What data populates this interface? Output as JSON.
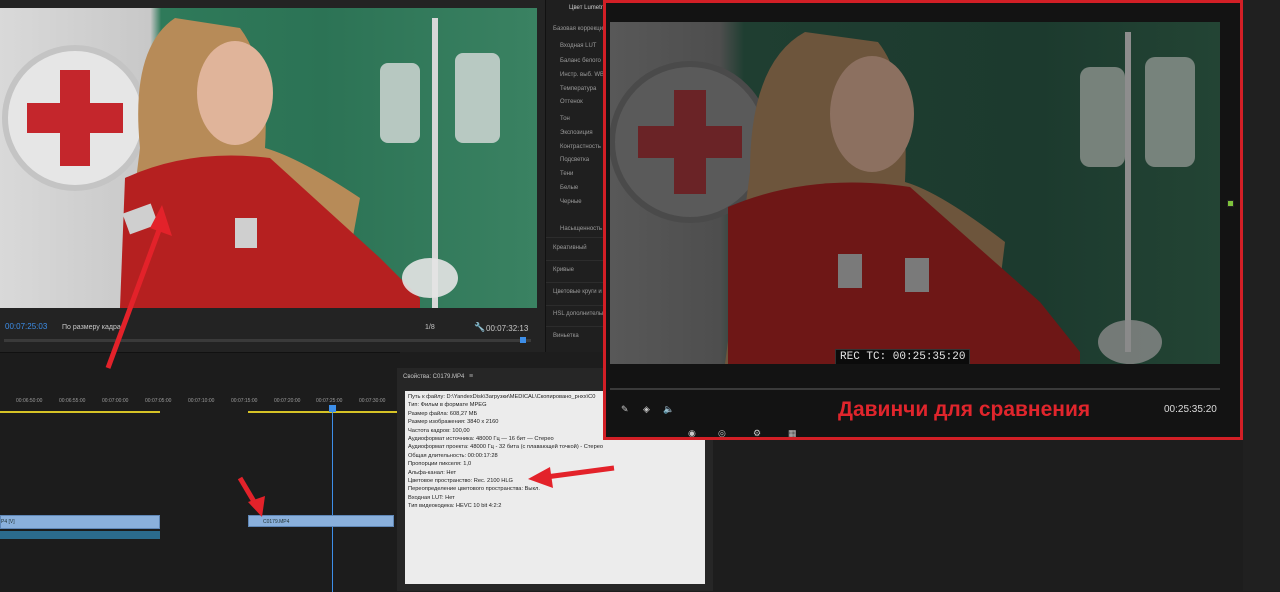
{
  "monitor": {
    "timecode_left": "00:07:25:03",
    "fit_label": "По размеру кадра",
    "resolution": "1/8",
    "timecode_right": "00:07:32:13"
  },
  "lumetri": {
    "tab": "Цвет Lumetri",
    "basic": "Базовая коррекция",
    "lut": "Входная LUT",
    "wb_group": "Баланс белого",
    "wb_picker": "Инстр. выб. WB",
    "temperature": "Температура",
    "tint": "Оттенок",
    "tone": "Тон",
    "exposure": "Экспозиция",
    "contrast": "Контрастность",
    "highlights": "Подсветка",
    "shadows": "Тени",
    "whites": "Белые",
    "blacks": "Черные",
    "saturation": "Насыщенность",
    "creative": "Креативный",
    "curves": "Кривые",
    "wheels": "Цветовые круги и к",
    "hsl": "HSL дополнительн",
    "vignette": "Виньетка"
  },
  "timeline": {
    "ticks": [
      "00:06:50:00",
      "00:06:55:00",
      "00:07:00:00",
      "00:07:05:00",
      "00:07:10:00",
      "00:07:15:00",
      "00:07:20:00",
      "00:07:25:00",
      "00:07:30:00"
    ],
    "clip_a": "P4 [V]",
    "clip_b": "C0179.MP4"
  },
  "properties": {
    "title": "Свойства: C0179.MP4",
    "lines": [
      "Путь к файлу: D:\\YandexDisk\\Загрузки\\MEDICAL\\Скопировано_рнхх\\C0",
      "Тип: Фильм в формате MPEG",
      "Размер файла: 608,27 МБ",
      "Размер изображения: 3840 x 2160",
      "Частота кадров: 100,00",
      "Аудиоформат источника: 48000 Гц — 16 бит — Стерео",
      "Аудиоформат проекта: 48000 Гц - 32 бита (с плавающей точкой) - Стерео",
      "Общая длительность: 00:00:17:28",
      "Пропорции пикселя: 1,0",
      "Альфа-канал: Нет",
      "Цветовое пространство: Rec. 2100 HLG",
      "Переопределение цветового пространства: Выкл.",
      "Входная LUT: Нет",
      "Тип видеокодека: HEVC 10 bit  4:2:2"
    ]
  },
  "davinci": {
    "rec_tc": "REC TC: 00:25:35:20",
    "label": "Давинчи для сравнения",
    "timecode": "00:25:35:20"
  },
  "colors": {
    "annotation_red": "#d21f26",
    "premiere_blue": "#3d8ee8"
  }
}
